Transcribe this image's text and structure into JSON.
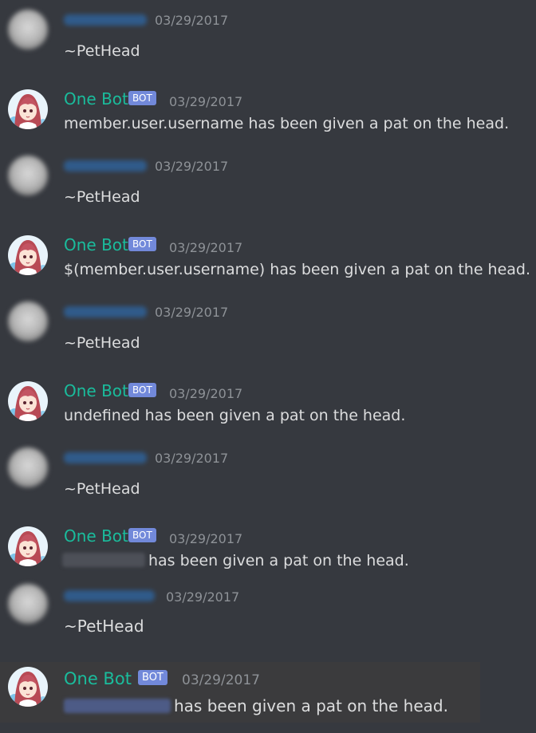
{
  "bot": {
    "name": "One Bot",
    "badge": "BOT"
  },
  "messages": [
    {
      "author": "user",
      "timestamp": "03/29/2017",
      "text": "~PetHead"
    },
    {
      "author": "bot",
      "timestamp": "03/29/2017",
      "text": "member.user.username has been given a pat on the head."
    },
    {
      "author": "user",
      "timestamp": "03/29/2017",
      "text": "~PetHead"
    },
    {
      "author": "bot",
      "timestamp": "03/29/2017",
      "text": "$(member.user.username) has been given a pat on the head."
    },
    {
      "author": "user",
      "timestamp": "03/29/2017",
      "text": "~PetHead"
    },
    {
      "author": "bot",
      "timestamp": "03/29/2017",
      "text": "undefined has been given a pat on the head."
    },
    {
      "author": "user",
      "timestamp": "03/29/2017",
      "text": "~PetHead"
    },
    {
      "author": "bot",
      "timestamp": "03/29/2017",
      "text": "has been given a pat on the head.",
      "mention_redacted": true
    },
    {
      "author": "user",
      "timestamp": "03/29/2017",
      "text": "~PetHead"
    },
    {
      "author": "bot",
      "timestamp": "03/29/2017",
      "text": "has been given a pat on the head.",
      "mention_redacted": true,
      "highlighted": true
    }
  ],
  "colors": {
    "background": "#36393f",
    "bot_name": "#1abc9c",
    "bot_badge": "#7289da",
    "timestamp": "#8e9297",
    "message_text": "#dcddde",
    "highlight": "#3b3b3d"
  }
}
